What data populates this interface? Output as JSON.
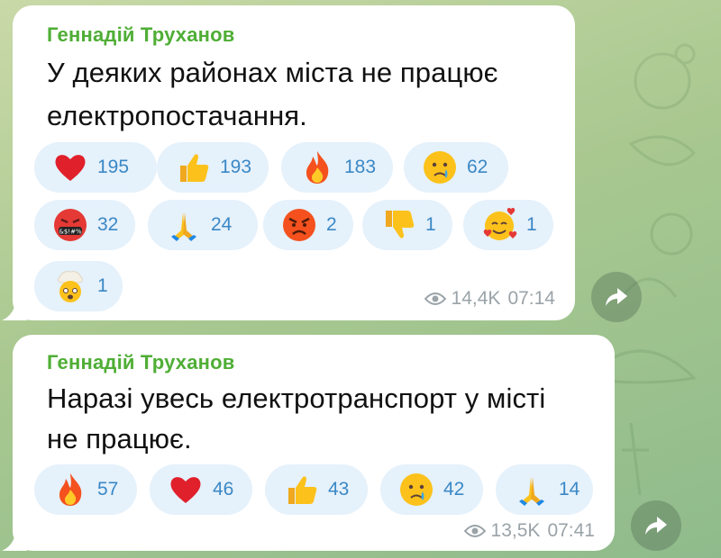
{
  "messages": [
    {
      "author": "Геннадій Труханов",
      "text_lines": [
        "У деяких районах міста не працює",
        "електропостачання."
      ],
      "reactions": [
        {
          "icon": "red-heart-icon",
          "count": "195"
        },
        {
          "icon": "thumbs-up-icon",
          "count": "193"
        },
        {
          "icon": "fire-icon",
          "count": "183"
        },
        {
          "icon": "crying-face-icon",
          "count": "62"
        },
        {
          "icon": "face-with-symbols-icon",
          "count": "32"
        },
        {
          "icon": "folded-hands-icon",
          "count": "24"
        },
        {
          "icon": "angry-face-icon",
          "count": "2"
        },
        {
          "icon": "thumbs-down-icon",
          "count": "1"
        },
        {
          "icon": "smiling-face-with-hearts-icon",
          "count": "1"
        },
        {
          "icon": "exploding-head-icon",
          "count": "1"
        }
      ],
      "views": "14,4K",
      "time": "07:14"
    },
    {
      "author": "Геннадій Труханов",
      "text_lines": [
        "Наразі увесь електротранспорт у місті",
        "не працює."
      ],
      "reactions": [
        {
          "icon": "fire-icon",
          "count": "57"
        },
        {
          "icon": "red-heart-icon",
          "count": "46"
        },
        {
          "icon": "thumbs-up-icon",
          "count": "43"
        },
        {
          "icon": "crying-face-icon",
          "count": "42"
        },
        {
          "icon": "folded-hands-icon",
          "count": "14"
        }
      ],
      "views": "13,5K",
      "time": "07:41"
    }
  ],
  "colors": {
    "author": "#4fae35",
    "reaction_bg": "#e5f1fb",
    "reaction_count": "#3a88c6",
    "meta": "#9aa3a8"
  }
}
